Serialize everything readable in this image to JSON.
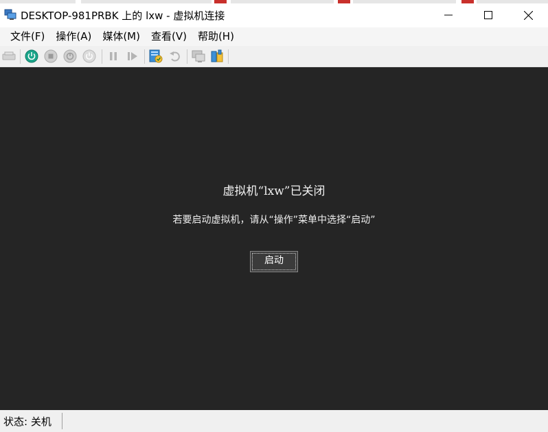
{
  "window": {
    "title": "DESKTOP-981PRBK 上的 lxw - 虚拟机连接"
  },
  "menu": {
    "items": [
      "文件(F)",
      "操作(A)",
      "媒体(M)",
      "查看(V)",
      "帮助(H)"
    ]
  },
  "toolbar": {
    "icons": [
      "ctrl-alt-del-icon",
      "start-icon",
      "turn-off-icon",
      "shut-down-icon",
      "save-icon",
      "pause-icon",
      "reset-icon",
      "checkpoint-icon",
      "revert-icon",
      "enhanced-session-icon",
      "share-icon"
    ]
  },
  "vm": {
    "off_title": "虚拟机“lxw”已关闭",
    "hint": "若要启动虚拟机，请从“操作”菜单中选择“启动”",
    "start_button": "启动"
  },
  "status": {
    "text": "状态: 关机"
  },
  "colors": {
    "screen_bg": "#252525",
    "start_green": "#1aa58a",
    "toolbar_bg": "#f0f0f0"
  }
}
